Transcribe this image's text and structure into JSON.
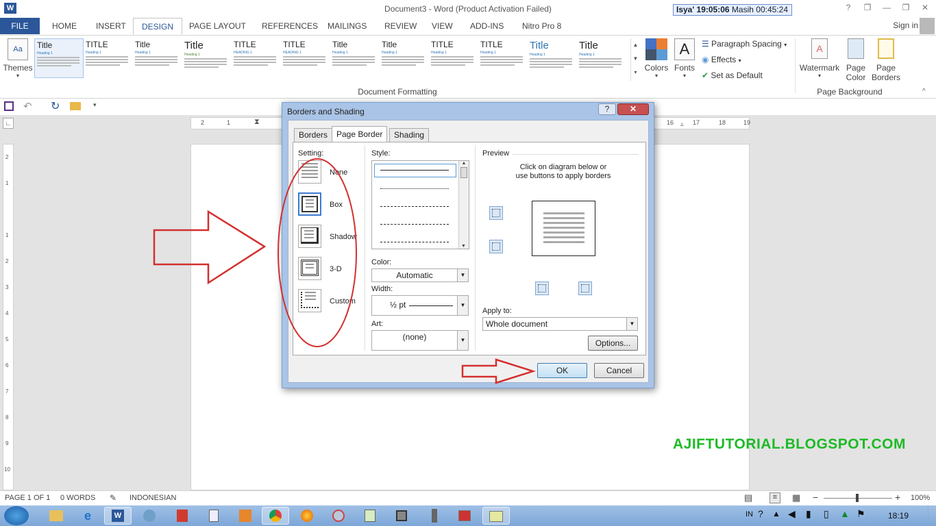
{
  "window": {
    "title": "Document3 - Word (Product Activation Failed)",
    "timer": {
      "prefix": "Isya' 19:05:06",
      "label": "Masih",
      "remaining": "00:45:24"
    },
    "controls": [
      "?",
      "❐",
      "—",
      "❐",
      "✕"
    ]
  },
  "ribbon_tabs": [
    "FILE",
    "HOME",
    "INSERT",
    "DESIGN",
    "PAGE LAYOUT",
    "REFERENCES",
    "MAILINGS",
    "REVIEW",
    "VIEW",
    "ADD-INS",
    "Nitro Pro 8"
  ],
  "active_tab": "DESIGN",
  "signin": "Sign in",
  "ribbon": {
    "themes": "Themes",
    "gallery": [
      {
        "title": "Title",
        "head": "Heading 1"
      },
      {
        "title": "TITLE",
        "head": "Heading 1"
      },
      {
        "title": "Title",
        "head": "Heading 1"
      },
      {
        "title": "Title",
        "head": "Heading 1"
      },
      {
        "title": "TITLE",
        "head": "HEADING 1"
      },
      {
        "title": "TITLE",
        "head": "HEADING 1"
      },
      {
        "title": "Title",
        "head": "Heading 1"
      },
      {
        "title": "Title",
        "head": "Heading 1"
      },
      {
        "title": "TITLE",
        "head": "Heading 1"
      },
      {
        "title": "TITLE",
        "head": "Heading 1"
      },
      {
        "title": "Title",
        "head": "Heading 1"
      },
      {
        "title": "Title",
        "head": "Heading 1"
      }
    ],
    "group_document_formatting": "Document Formatting",
    "colors": "Colors",
    "fonts": "Fonts",
    "paragraph_spacing": "Paragraph Spacing",
    "effects": "Effects",
    "set_default": "Set as Default",
    "watermark": "Watermark",
    "page_color": [
      "Page",
      "Color"
    ],
    "page_borders": [
      "Page",
      "Borders"
    ],
    "group_page_background": "Page Background"
  },
  "ruler": {
    "h_ticks": [
      "2",
      "1",
      "16",
      "17",
      "18",
      "19"
    ],
    "v_ticks": [
      "2",
      "1",
      "1",
      "2",
      "3",
      "4",
      "5",
      "6",
      "7",
      "8",
      "9",
      "10"
    ]
  },
  "dialog": {
    "title": "Borders and Shading",
    "help": "?",
    "close": "✕",
    "tabs": [
      "Borders",
      "Page Border",
      "Shading"
    ],
    "setting_label": "Setting:",
    "settings": [
      "None",
      "Box",
      "Shadow",
      "3-D",
      "Custom"
    ],
    "style_label": "Style:",
    "color_label": "Color:",
    "color_value": "Automatic",
    "width_label": "Width:",
    "width_value": "½ pt",
    "art_label": "Art:",
    "art_value": "(none)",
    "preview_label": "Preview",
    "preview_hint_1": "Click on diagram below or",
    "preview_hint_2": "use buttons to apply borders",
    "apply_label": "Apply to:",
    "apply_value": "Whole document",
    "options": "Options...",
    "ok": "OK",
    "cancel": "Cancel"
  },
  "watermark_text": "AJIFTUTORIAL.BLOGSPOT.COM",
  "status": {
    "page": "PAGE 1 OF 1",
    "words": "0 WORDS",
    "language": "INDONESIAN",
    "zoom": "100%"
  },
  "taskbar": {
    "lang": "IN",
    "clock": "18:19"
  },
  "colors": {
    "accent": "#2b579a",
    "annotation": "#d32f2f",
    "watermark": "#1dba26"
  }
}
